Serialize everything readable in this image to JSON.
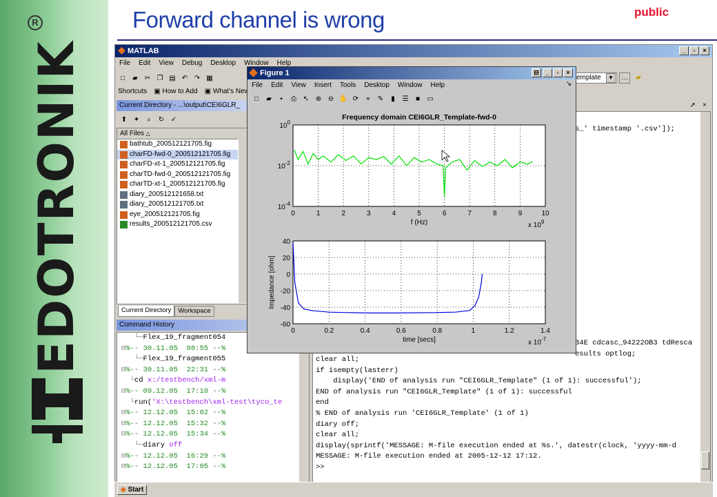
{
  "slide": {
    "title": "Forward channel is wrong",
    "tag": "public",
    "brand": "EDOTRONIK",
    "reg": "R"
  },
  "matlab": {
    "title": "MATLAB",
    "menu": [
      "File",
      "Edit",
      "View",
      "Debug",
      "Desktop",
      "Window",
      "Help"
    ],
    "shortcuts": [
      "Shortcuts",
      "How to Add",
      "What's New"
    ],
    "template_combo": "emplate",
    "current_dir_title": "Current Directory - ...\\output\\CEI6GLR_",
    "all_files_label": "All Files",
    "files": [
      {
        "name": "bathtub_200512121705.fig",
        "type": "fig"
      },
      {
        "name": "charFD-fwd-0_200512121705.fig",
        "type": "fig",
        "selected": true
      },
      {
        "name": "charFD-xt-1_200512121705.fig",
        "type": "fig"
      },
      {
        "name": "charTD-fwd-0_200512121705.fig",
        "type": "fig"
      },
      {
        "name": "charTD-xt-1_200512121705.fig",
        "type": "fig"
      },
      {
        "name": "diary_200512121658.txt",
        "type": "txt"
      },
      {
        "name": "diary_200512121705.txt",
        "type": "txt"
      },
      {
        "name": "eye_200512121705.fig",
        "type": "fig"
      },
      {
        "name": "results_200512121705.csv",
        "type": "csv"
      }
    ],
    "tabs": [
      "Current Directory",
      "Workspace"
    ],
    "history_title": "Command History",
    "history": [
      {
        "text": "Flex_19_fragment054",
        "kind": "cmd",
        "indent": 2
      },
      {
        "text": "%-- 30.11.05  08:55 --%",
        "kind": "time",
        "indent": 0
      },
      {
        "text": "Flex_19_fragment055",
        "kind": "cmd",
        "indent": 2
      },
      {
        "text": "%-- 30.11.05  22:31 --%",
        "kind": "time",
        "indent": 0
      },
      {
        "text": "cd x:/testbench/xml-m",
        "kind": "cd",
        "indent": 1
      },
      {
        "text": "%-- 09.12.05  17:10 --%",
        "kind": "time",
        "indent": 0
      },
      {
        "text": "run('X:\\testbench\\xml-test\\tyco_te",
        "kind": "run",
        "indent": 1
      },
      {
        "text": "%-- 12.12.05  15:02 --%",
        "kind": "time",
        "indent": 0
      },
      {
        "text": "%-- 12.12.05  15:32 --%",
        "kind": "time",
        "indent": 0
      },
      {
        "text": "%-- 12.12.05  15:34 --%",
        "kind": "time",
        "indent": 0
      },
      {
        "text": "diary off",
        "kind": "diary",
        "indent": 2
      },
      {
        "text": "%-- 12.12.05  16:29 --%",
        "kind": "time",
        "indent": 0
      },
      {
        "text": "%-- 12.12.05  17:05 --%",
        "kind": "time",
        "indent": 0
      }
    ],
    "cmd_top": [
      "s_' timestamp '.csv']);"
    ],
    "cmd_mid": [
      "34E cdcasc_94222OB3 tdResca",
      "esults optlog;"
    ],
    "cmd_lines": [
      "clear all;",
      "if isempty(lasterr)",
      "    display('END of analysis run \"CEI6GLR_Template\" (1 of 1): successful');",
      "END of analysis run \"CEI6GLR_Template\" (1 of 1): successful",
      "end",
      "% END of analysis run 'CEI6GLR_Template' (1 of 1)",
      "diary off;",
      "clear all;",
      "display(sprintf('MESSAGE: M-file execution ended at %s.', datestr(clock, 'yyyy-mm-d",
      "MESSAGE: M-file execution ended at 2005-12-12 17:12.",
      ">>"
    ],
    "start": "Start"
  },
  "figure": {
    "title": "Figure 1",
    "menu": [
      "File",
      "Edit",
      "View",
      "Insert",
      "Tools",
      "Desktop",
      "Window",
      "Help"
    ]
  },
  "chart_data": [
    {
      "type": "line",
      "title": "Frequency domain CEI6GLR_Template-fwd-0",
      "xlabel": "f (Hz)",
      "x_multiplier": "x 10^9",
      "yscale": "log",
      "ylim": [
        0.0001,
        1
      ],
      "xlim": [
        0,
        10
      ],
      "xticks": [
        "0",
        "1",
        "2",
        "3",
        "4",
        "5",
        "6",
        "7",
        "8",
        "9",
        "10"
      ],
      "yticks": [
        "10^0",
        "10^-2",
        "10^-4"
      ],
      "grid": true,
      "color": "#00e000",
      "series": [
        {
          "x": [
            0.05,
            0.2,
            0.4,
            0.6,
            0.8,
            1.0,
            1.2,
            1.5,
            1.8,
            2.1,
            2.4,
            2.7,
            3.0,
            3.3,
            3.6,
            3.9,
            4.2,
            4.5,
            4.8,
            5.1,
            5.4,
            5.7,
            5.95,
            6.0,
            6.05,
            6.3,
            6.6,
            6.9,
            7.2,
            7.5,
            7.8,
            8.1,
            8.4,
            8.7,
            9.0,
            9.3,
            9.5
          ],
          "y": [
            0.06,
            0.02,
            0.05,
            0.012,
            0.04,
            0.02,
            0.03,
            0.015,
            0.035,
            0.018,
            0.03,
            0.012,
            0.025,
            0.02,
            0.028,
            0.012,
            0.03,
            0.01,
            0.025,
            0.015,
            0.02,
            0.012,
            0.01,
            0.0003,
            0.008,
            0.015,
            0.02,
            0.006,
            0.018,
            0.009,
            0.015,
            0.01,
            0.02,
            0.008,
            0.015,
            0.012,
            0.016
          ]
        }
      ]
    },
    {
      "type": "line",
      "xlabel": "time [secs]",
      "ylabel": "Impedance [ohm]",
      "x_multiplier": "x 10^-7",
      "xlim": [
        0,
        1.4
      ],
      "ylim": [
        -60,
        40
      ],
      "xticks": [
        "0",
        "0.2",
        "0.4",
        "0.6",
        "0.8",
        "1",
        "1.2",
        "1.4"
      ],
      "yticks": [
        "40",
        "20",
        "0",
        "-20",
        "-40",
        "-60"
      ],
      "grid": true,
      "color": "#0000dd",
      "series": [
        {
          "x": [
            0.0,
            0.01,
            0.03,
            0.06,
            0.1,
            0.2,
            0.4,
            0.6,
            0.8,
            0.9,
            0.98,
            1.01,
            1.03,
            1.045,
            1.05
          ],
          "y": [
            38,
            -10,
            -35,
            -42,
            -44,
            -46,
            -47,
            -47,
            -46.5,
            -46,
            -44,
            -38,
            -28,
            -10,
            0
          ]
        }
      ]
    }
  ]
}
